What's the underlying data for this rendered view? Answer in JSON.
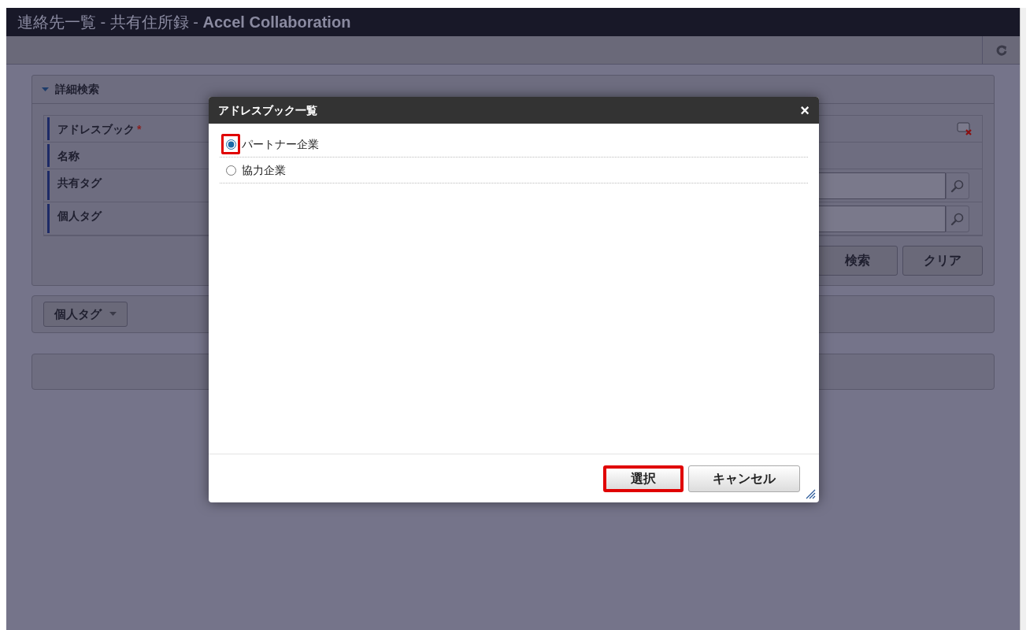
{
  "window": {
    "title": "連絡先一覧 - 共有住所録 - **Accel Collaboration**"
  },
  "search_panel": {
    "title": "詳細検索",
    "expanded": true,
    "fields": [
      {
        "label": "アドレスブック",
        "required_mark": "*",
        "kind": "clear"
      },
      {
        "label": "名称",
        "kind": "empty"
      },
      {
        "label": "共有タグ",
        "kind": "search"
      },
      {
        "label": "個人タグ",
        "kind": "search"
      }
    ],
    "buttons": [
      "検索",
      "クリア"
    ]
  },
  "tag_dropdown": {
    "label": "個人タグ"
  },
  "dialog": {
    "title": "アドレスブック一覧",
    "close": "×",
    "options": [
      {
        "label": "パートナー企業",
        "selected": true,
        "highlighted": true
      },
      {
        "label": "協力企業",
        "selected": false,
        "highlighted": false
      }
    ],
    "buttons": [
      {
        "label": "選択",
        "highlighted": true
      },
      {
        "label": "キャンセル",
        "highlighted": false
      }
    ]
  }
}
